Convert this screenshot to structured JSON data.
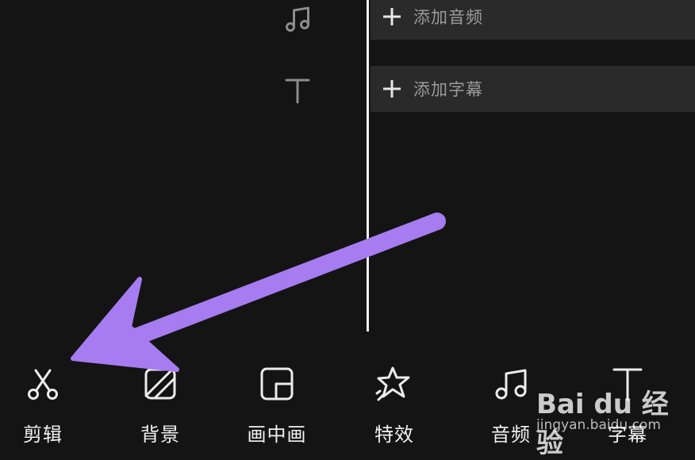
{
  "tracks": {
    "audio": {
      "icon": "music-note-icon",
      "label": "添加音频"
    },
    "subtitle": {
      "icon": "text-t-icon",
      "label": "添加字幕"
    }
  },
  "toolbar": {
    "items": [
      {
        "icon": "scissors-icon",
        "label": "剪辑"
      },
      {
        "icon": "background-icon",
        "label": "背景"
      },
      {
        "icon": "picture-in-picture-icon",
        "label": "画中画"
      },
      {
        "icon": "star-sparkle-icon",
        "label": "特效"
      },
      {
        "icon": "music-note-icon",
        "label": "音频"
      },
      {
        "icon": "text-t-icon",
        "label": "字幕"
      }
    ]
  },
  "watermark": {
    "logo": "Bai du 经验",
    "url": "jingyan.baidu.com"
  },
  "colors": {
    "background": "#141414",
    "track_bar": "#2a2a2b",
    "arrow": "#a67cf0",
    "playhead": "#f2f2f2"
  }
}
